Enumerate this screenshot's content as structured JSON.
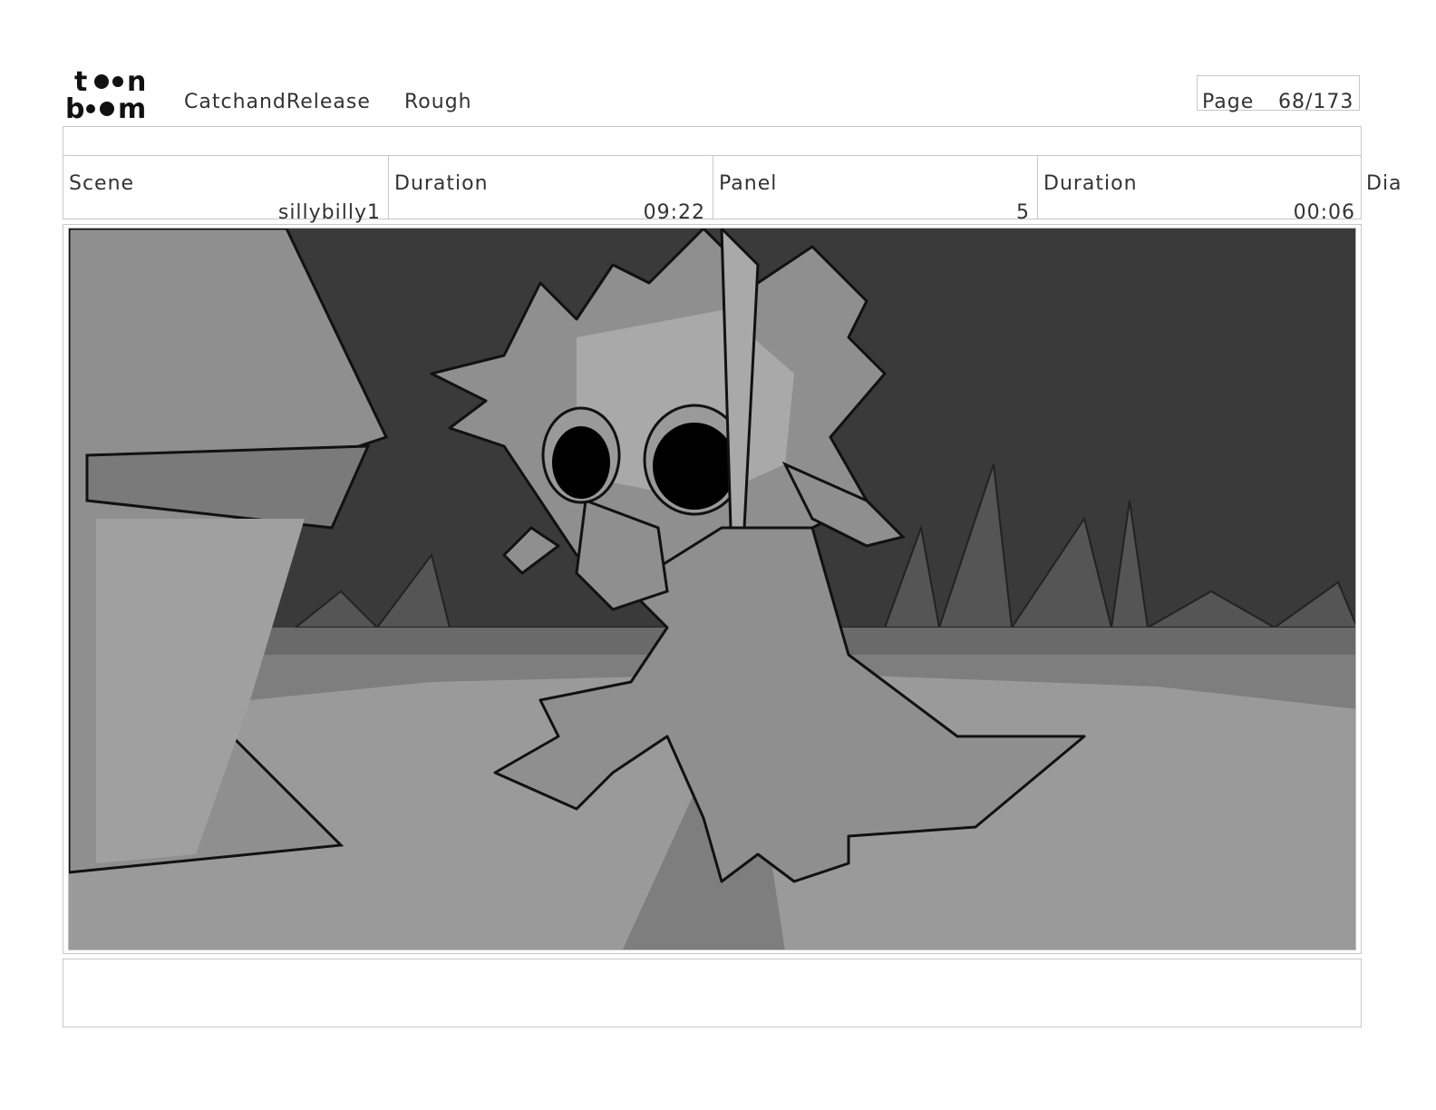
{
  "header": {
    "logo_text": "toonboom",
    "project": "CatchandRelease",
    "stage": "Rough",
    "page_label": "Page",
    "page_value": "68/173"
  },
  "info": {
    "scene_label": "Scene",
    "scene_value": "sillybilly1",
    "scene_duration_label": "Duration",
    "scene_duration_value": "09:22",
    "panel_label": "Panel",
    "panel_value": "5",
    "panel_duration_label": "Duration",
    "panel_duration_value": "00:06",
    "dialogue_label": "Dia"
  },
  "panel": {
    "palette": {
      "sky": "#3a3a3a",
      "ground": "#9a9a9a",
      "ground_shadow": "#7e7e7e",
      "character": "#8f8f8f",
      "character_light": "#a9a9a9",
      "outline": "#111111"
    }
  },
  "notes": {
    "text": ""
  }
}
